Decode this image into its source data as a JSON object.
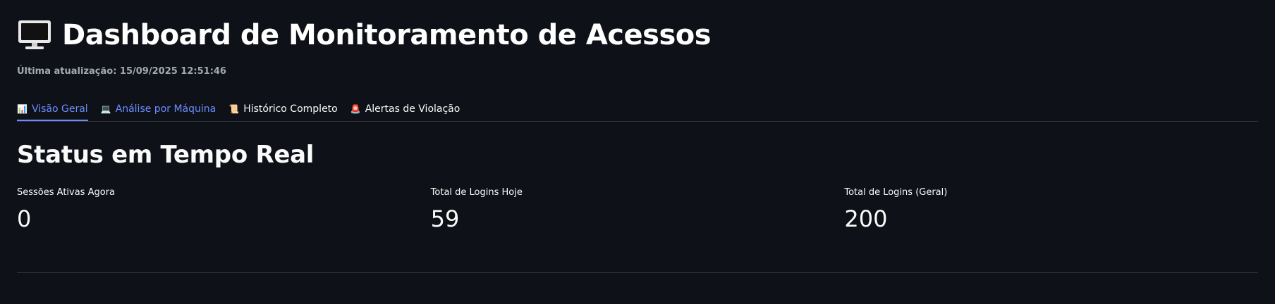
{
  "header": {
    "title": "Dashboard de Monitoramento de Acessos",
    "icon": "monitor-icon",
    "last_update": "Última atualização: 15/09/2025 12:51:46"
  },
  "tabs": [
    {
      "icon": "📊",
      "label": "Visão Geral",
      "active": true
    },
    {
      "icon": "💻",
      "label": "Análise por Máquina",
      "active": false
    },
    {
      "icon": "📜",
      "label": "Histórico Completo",
      "active": false
    },
    {
      "icon": "🚨",
      "label": "Alertas de Violação",
      "active": false
    }
  ],
  "section": {
    "title": "Status em Tempo Real"
  },
  "metrics": [
    {
      "label": "Sessões Ativas Agora",
      "value": "0"
    },
    {
      "label": "Total de Logins Hoje",
      "value": "59"
    },
    {
      "label": "Total de Logins (Geral)",
      "value": "200"
    }
  ],
  "colors": {
    "background": "#0e1117",
    "accent": "#6c8cff",
    "divider": "#31333f"
  }
}
